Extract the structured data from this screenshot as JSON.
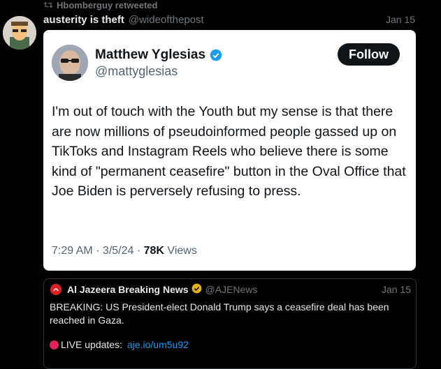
{
  "retweet": {
    "label": "Hbomberguy retweeted"
  },
  "post": {
    "author_name": "austerity is theft",
    "author_handle": "@wideofthepost",
    "date": "Jan 15"
  },
  "embed": {
    "author_name": "Matthew Yglesias",
    "author_handle": "@mattyglesias",
    "follow_label": "Follow",
    "body": "I'm out of touch with the Youth but my sense is that there are now millions of pseudoinformed people gassed up on TikToks and Instagram Reels who believe there is some kind of \"permanent ceasefire\" button in the Oval Office that Joe Biden is perversely refusing to press.",
    "time": "7:29 AM · 3/5/24 · ",
    "views_count": "78K",
    "views_label": " Views"
  },
  "quote": {
    "author_name": "Al Jazeera Breaking News",
    "author_handle": "@AJENews",
    "date": "Jan 15",
    "text": "BREAKING: US President-elect Donald Trump says a ceasefire deal has been reached in Gaza.",
    "live_label": "LIVE updates:",
    "link": "aje.io/um5u92"
  },
  "colors": {
    "background": "#000000",
    "verified_blue": "#1d9bf0",
    "verified_gold": "#e8b30c",
    "link": "#1d9bf0",
    "live_dot": "#e0245e"
  }
}
